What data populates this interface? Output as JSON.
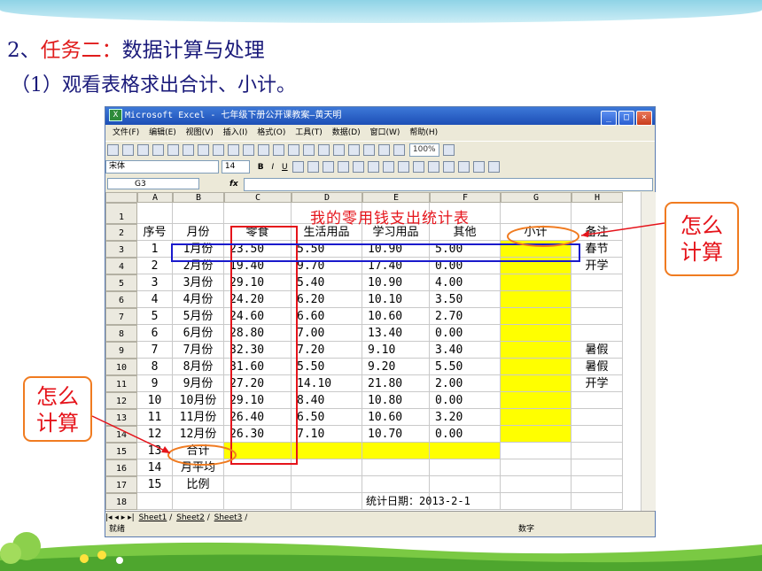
{
  "slide": {
    "heading_num": "2、",
    "heading_red": "任务二：",
    "heading_rest": "数据计算与处理",
    "subheading": "（1）观看表格求出合计、小计。",
    "callout_right": [
      "怎么",
      "计算"
    ],
    "callout_left": [
      "怎么",
      "计算"
    ]
  },
  "excel": {
    "title": "Microsoft Excel - 七年级下册公开课教案—黄天明",
    "menu": [
      "文件(F)",
      "编辑(E)",
      "视图(V)",
      "插入(I)",
      "格式(O)",
      "工具(T)",
      "数据(D)",
      "窗口(W)",
      "帮助(H)"
    ],
    "zoom": "100%",
    "font_name": "宋体",
    "font_size": "14",
    "name_box": "G3",
    "fx": "fx",
    "columns": [
      "A",
      "B",
      "C",
      "D",
      "E",
      "F",
      "G",
      "H"
    ],
    "rows": [
      "1",
      "2",
      "3",
      "4",
      "5",
      "6",
      "7",
      "8",
      "9",
      "10",
      "11",
      "12",
      "13",
      "14",
      "15",
      "16",
      "17",
      "18"
    ],
    "table_title": "我的零用钱支出统计表",
    "headers": [
      "序号",
      "月份",
      "零食",
      "生活用品",
      "学习用品",
      "其他",
      "小计",
      "备注"
    ],
    "data": [
      [
        "1",
        "1月份",
        "23.50",
        "5.50",
        "10.90",
        "5.00",
        "",
        "春节"
      ],
      [
        "2",
        "2月份",
        "19.40",
        "9.70",
        "17.40",
        "0.00",
        "",
        "开学"
      ],
      [
        "3",
        "3月份",
        "29.10",
        "5.40",
        "10.90",
        "4.00",
        "",
        ""
      ],
      [
        "4",
        "4月份",
        "24.20",
        "6.20",
        "10.10",
        "3.50",
        "",
        ""
      ],
      [
        "5",
        "5月份",
        "24.60",
        "6.60",
        "10.60",
        "2.70",
        "",
        ""
      ],
      [
        "6",
        "6月份",
        "28.80",
        "7.00",
        "13.40",
        "0.00",
        "",
        ""
      ],
      [
        "7",
        "7月份",
        "32.30",
        "7.20",
        "9.10",
        "3.40",
        "",
        "暑假"
      ],
      [
        "8",
        "8月份",
        "31.60",
        "5.50",
        "9.20",
        "5.50",
        "",
        "暑假"
      ],
      [
        "9",
        "9月份",
        "27.20",
        "14.10",
        "21.80",
        "2.00",
        "",
        "开学"
      ],
      [
        "10",
        "10月份",
        "29.10",
        "8.40",
        "10.80",
        "0.00",
        "",
        ""
      ],
      [
        "11",
        "11月份",
        "26.40",
        "6.50",
        "10.60",
        "3.20",
        "",
        ""
      ],
      [
        "12",
        "12月份",
        "26.30",
        "7.10",
        "10.70",
        "0.00",
        "",
        ""
      ]
    ],
    "row15": [
      "13",
      "合计"
    ],
    "row16": [
      "14",
      "月平均"
    ],
    "row17": [
      "15",
      "比例"
    ],
    "stat_date": "统计日期：2013-2-1",
    "sheets": [
      "Sheet1",
      "Sheet2",
      "Sheet3"
    ],
    "status_left": "就绪",
    "status_right": "数字",
    "colors": {
      "highlight": "#ffff00",
      "red_title": "#e5141b",
      "callout_border": "#f07b20",
      "blue_box": "#1a1acc"
    }
  }
}
